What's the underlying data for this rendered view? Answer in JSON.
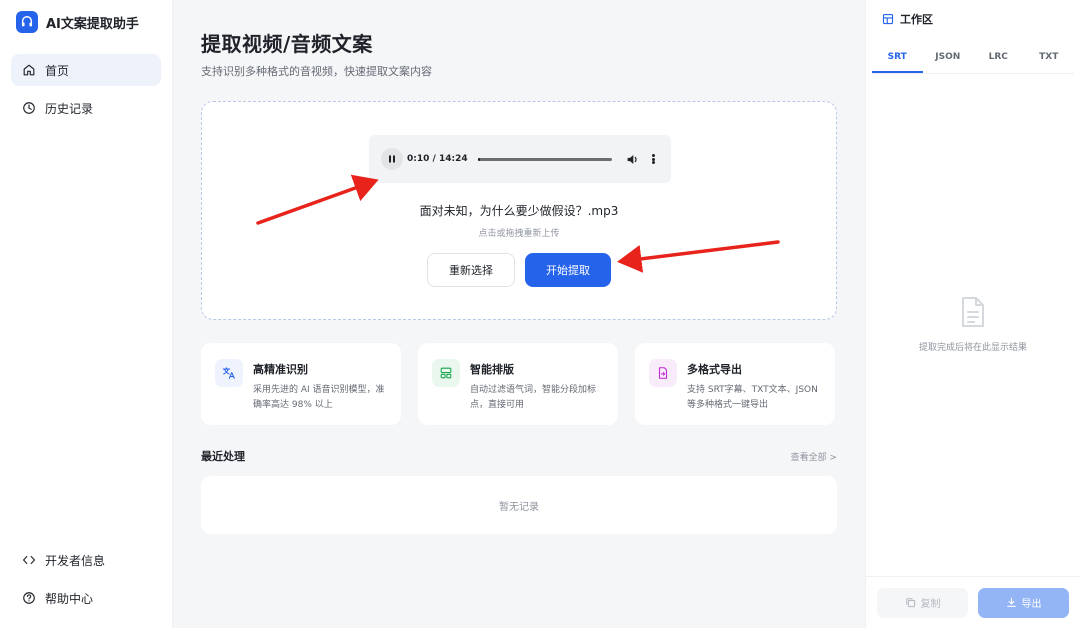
{
  "app": {
    "title": "AI文案提取助手"
  },
  "sidebar": {
    "items": [
      {
        "label": "首页",
        "icon": "home-icon",
        "active": true
      },
      {
        "label": "历史记录",
        "icon": "history-icon",
        "active": false
      }
    ],
    "bottom_items": [
      {
        "label": "开发者信息",
        "icon": "code-icon"
      },
      {
        "label": "帮助中心",
        "icon": "help-icon"
      }
    ]
  },
  "main": {
    "title": "提取视频/音频文案",
    "subtitle": "支持识别多种格式的音视频，快速提取文案内容",
    "player": {
      "time": "0:10 / 14:24",
      "progress_fraction": 0.012
    },
    "file_name": "面对未知，为什么要少做假设？.mp3",
    "file_hint": "点击或拖拽重新上传",
    "reselect_label": "重新选择",
    "start_label": "开始提取",
    "features": [
      {
        "title": "高精准识别",
        "desc": "采用先进的 AI 语音识别模型，准确率高达 98% 以上",
        "icon": "translate-icon",
        "color": "#2563eb",
        "bg": "#eef3fd"
      },
      {
        "title": "智能排版",
        "desc": "自动过滤语气词，智能分段加标点，直接可用",
        "icon": "layout-icon",
        "color": "#16a34a",
        "bg": "#eaf7ee"
      },
      {
        "title": "多格式导出",
        "desc": "支持 SRT字幕、TXT文本、JSON 等多种格式一键导出",
        "icon": "export-file-icon",
        "color": "#c026d3",
        "bg": "#f8ecfb"
      }
    ],
    "recent": {
      "title": "最近处理",
      "view_all": "查看全部 >",
      "empty": "暂无记录"
    }
  },
  "workspace": {
    "title": "工作区",
    "tabs": [
      "SRT",
      "JSON",
      "LRC",
      "TXT"
    ],
    "active_tab": "SRT",
    "empty_text": "提取完成后将在此显示结果",
    "copy_label": "复制",
    "export_label": "导出"
  },
  "colors": {
    "accent": "#2563eb",
    "annotation_arrow": "#e8231b"
  }
}
